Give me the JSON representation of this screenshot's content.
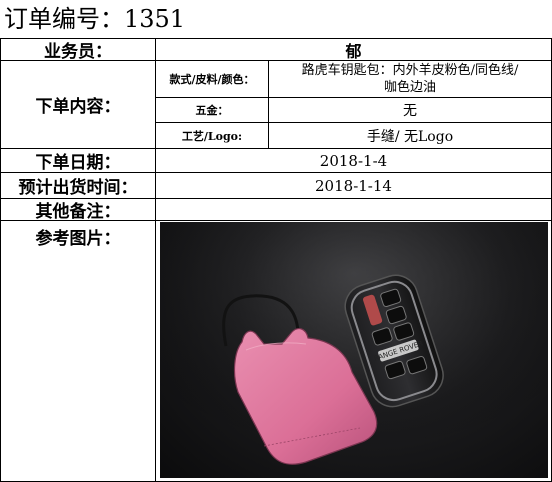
{
  "title": "订单编号：1351",
  "rows": {
    "salesperson": {
      "label": "业务员：",
      "value": "郁"
    },
    "content": {
      "label": "下单内容：",
      "style": {
        "label": "款式/皮料/颜色：",
        "value_line1": "路虎车钥匙包：内外羊皮粉色/同色线/",
        "value_line2": "咖色边油"
      },
      "hardware": {
        "label": "五金：",
        "value": "无"
      },
      "craft": {
        "label": "工艺/Logo:",
        "value": "手缝/ 无Logo"
      }
    },
    "order_date": {
      "label": "下单日期：",
      "value": "2018-1-4"
    },
    "ship_date": {
      "label": "预计出货时间：",
      "value": "2018-1-14"
    },
    "notes": {
      "label": "其他备注：",
      "value": ""
    },
    "reference": {
      "label": "参考图片："
    }
  },
  "photo": {
    "key_brand": "RANGE ROVER"
  },
  "colors": {
    "border": "#000000",
    "leather": "#e07a9e",
    "background": "#1c1c1e"
  }
}
